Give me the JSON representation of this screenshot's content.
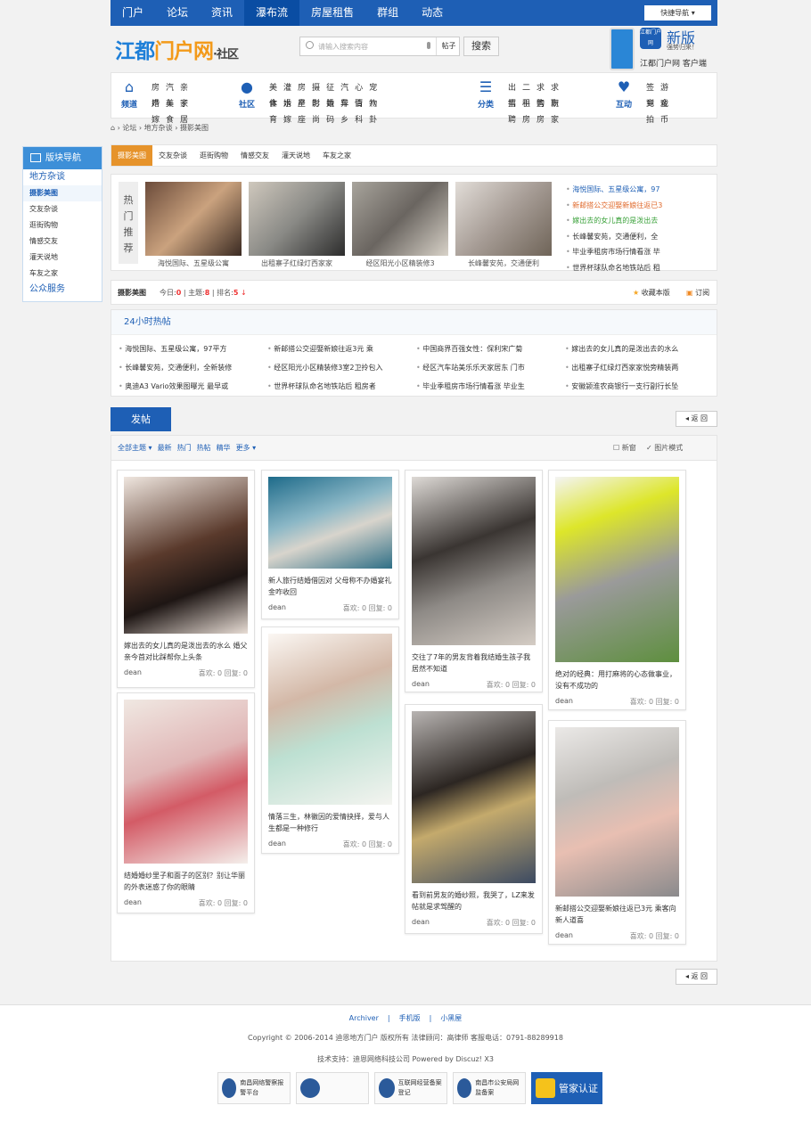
{
  "topnav": {
    "items": [
      "门户",
      "论坛",
      "资讯",
      "瀑布流",
      "房屋租售",
      "群组",
      "动态"
    ],
    "active": 3,
    "quick": "快捷导航 ▾"
  },
  "header": {
    "logo_a": "江都",
    "logo_b": "门户网",
    "logo_c": "·社区",
    "search_placeholder": "请输入搜索内容",
    "search_scope": "帖子",
    "search_button": "搜索",
    "app_icon": "江都门户网",
    "app_new": "新版",
    "app_sub": "强势归来！",
    "app_name": "江都门户网 客户端"
  },
  "catnav": [
    {
      "label": "频道",
      "icon": "⌂",
      "links": [
        "房产",
        "婚嫁",
        "汽车",
        "美食",
        "亲子",
        "家居"
      ]
    },
    {
      "label": "社区",
      "icon": "●",
      "links": [
        "美食",
        "体育",
        "灌水",
        "婚嫁",
        "房产",
        "星座",
        "摄影",
        "时尚",
        "征婚",
        "数码",
        "汽车",
        "异乡",
        "心情",
        "百科",
        "宠物",
        "八卦"
      ]
    },
    {
      "label": "分类",
      "icon": "☰",
      "links": [
        "出售",
        "招聘",
        "二手",
        "租房",
        "求购",
        "售房",
        "求职",
        "商家"
      ]
    },
    {
      "label": "互动",
      "icon": "♥",
      "links": [
        "签到",
        "竞拍",
        "游戏",
        "金币"
      ]
    }
  ],
  "breadcrumb": {
    "items": [
      "论坛",
      "地方杂谈",
      "摄影美图"
    ]
  },
  "sidebar": {
    "title": "版块导航",
    "items": [
      {
        "label": "地方杂谈",
        "big": true
      },
      {
        "label": "摄影美图",
        "on": true
      },
      {
        "label": "交友杂谈"
      },
      {
        "label": "逛街购物"
      },
      {
        "label": "情感交友"
      },
      {
        "label": "灌天说地"
      },
      {
        "label": "车友之家"
      },
      {
        "label": "公众服务",
        "big": true
      }
    ]
  },
  "subtabs": {
    "items": [
      "摄影美图",
      "交友杂谈",
      "逛街购物",
      "情感交友",
      "灌天说地",
      "车友之家"
    ],
    "active": 0
  },
  "recommend": {
    "tab": "热门推荐",
    "pics": [
      {
        "caption": "海悦国际、五星级公寓"
      },
      {
        "caption": "出租寨子红绿灯西家家"
      },
      {
        "caption": "经区阳光小区精装修3"
      },
      {
        "caption": "长峰馨安苑，交通便利"
      }
    ],
    "list": [
      {
        "text": "海悦国际、五星级公寓，97",
        "color": "#1e5fb5"
      },
      {
        "text": "新邮搭公交迎娶新娘往返已3",
        "color": "#e06a2c"
      },
      {
        "text": "嫁出去的女儿真的是泼出去",
        "color": "#3aa13a"
      },
      {
        "text": "长峰馨安苑，交通便利，全",
        "color": "#333333"
      },
      {
        "text": "毕业季租房市场行情看涨 毕",
        "color": "#333333"
      },
      {
        "text": "世界杯球队命名地铁站后 租",
        "color": "#333333"
      }
    ]
  },
  "forumbar": {
    "title": "摄影美图",
    "today_label": "今日:",
    "today": "0",
    "topics_label": "主题:",
    "topics": "8",
    "rank_label": "排名:",
    "rank": "5",
    "fav": "收藏本版",
    "rss": "订阅"
  },
  "hot": {
    "title": "24小时热帖",
    "items": [
      "海悦国际、五星级公寓，97平方",
      "新邮搭公交迎娶新娘往返3元 乘",
      "中国商界百强女性：保利宋广菊",
      "嫁出去的女儿真的是泼出去的水么",
      "长峰馨安苑，交通便利，全新装修",
      "经区阳光小区精装修3室2卫拎包入",
      "经区汽车站美乐乐天家居东 门市",
      "出租寨子红绿灯西家家悦旁精装两",
      "奥迪A3 Vario效果图曝光 最早或",
      "世界杯球队命名地铁站后 租房者",
      "毕业季租房市场行情看涨 毕业生",
      "安徽颍淮农商银行一支行副行长坠"
    ]
  },
  "post_button": "发帖",
  "back": "返 回",
  "filter": {
    "items": [
      "全部主题 ▾",
      "最新",
      "热门",
      "热帖",
      "精华",
      "更多 ▾"
    ],
    "newwin": "新窗",
    "picmode": "图片模式"
  },
  "cards": [
    {
      "title": "嫁出去的女儿真的是泼出去的水么 婚父亲今首对比踩帮你上头条",
      "author": "dean",
      "likes": "喜欢: 0",
      "replies": "回复: 0"
    },
    {
      "title": "结婚婚纱里子和面子的区别？别让华丽的外表迷惑了你的眼睛",
      "author": "dean",
      "likes": "喜欢: 0",
      "replies": "回复: 0"
    },
    {
      "title": "新人旅行结婚借因对 父母称不办婚宴礼金咋收回",
      "author": "dean",
      "likes": "喜欢: 0",
      "replies": "回复: 0"
    },
    {
      "title": "情落三生，林徽因的爱情抉择，爱与人生都是一种修行",
      "author": "dean",
      "likes": "喜欢: 0",
      "replies": "回复: 0"
    },
    {
      "title": "交往了7年的男友背着我结婚生孩子我居然不知道",
      "author": "dean",
      "likes": "喜欢: 0",
      "replies": "回复: 0"
    },
    {
      "title": "看到前男友的婚纱照，我哭了，LZ来发帖就是求驾醒的",
      "author": "dean",
      "likes": "喜欢: 0",
      "replies": "回复: 0"
    },
    {
      "title": "绝对的经典：用打麻将的心态做事业，没有不成功的",
      "author": "dean",
      "likes": "喜欢: 0",
      "replies": "回复: 0"
    },
    {
      "title": "新邮搭公交迎娶新娘往返已3元 乘客向新人道喜",
      "author": "dean",
      "likes": "喜欢: 0",
      "replies": "回复: 0"
    }
  ],
  "footer": {
    "links": [
      "Archiver",
      "手机版",
      "小黑屋"
    ],
    "copyright": "Copyright © 2006-2014  迪恩地方门户 版权所有   法律顾问：高律师   客服电话：0791-88289918",
    "tech": "技术支持：迪恩网络科技公司  Powered by Discuz! X3",
    "badges": [
      {
        "text": "南昌网络警察报警平台"
      },
      {
        "text": ""
      },
      {
        "text": "互联网经营备案登记"
      },
      {
        "text": "南昌市公安局网监备案"
      },
      {
        "text": "管家认证"
      }
    ]
  },
  "colors": {
    "primary": "#1e5fb5",
    "accent": "#e6932b"
  }
}
